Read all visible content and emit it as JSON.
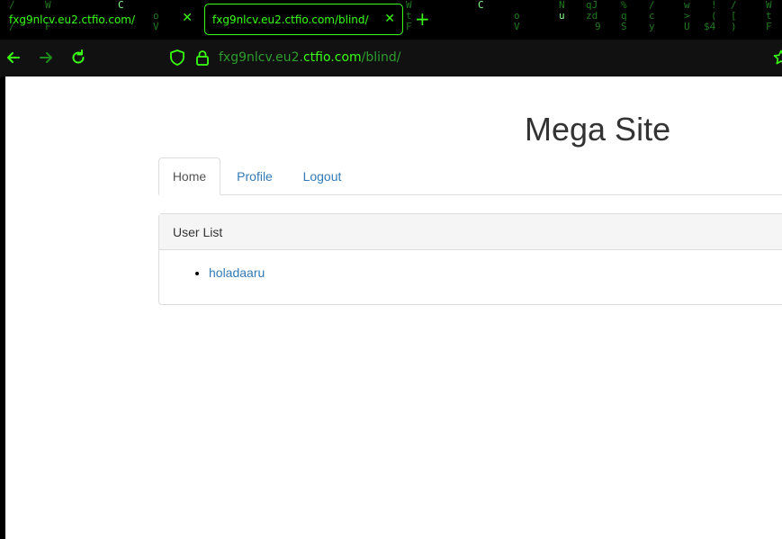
{
  "browser": {
    "tabs": [
      {
        "label": "fxg9nlcv.eu2.ctfio.com/",
        "active": false
      },
      {
        "label": "fxg9nlcv.eu2.ctfio.com/blind/",
        "active": true
      }
    ],
    "close_glyph": "✕",
    "new_tab_glyph": "+",
    "url": {
      "prefix": "fxg9nlcv.eu2.",
      "host": "ctfio.com",
      "path": "/blind/"
    },
    "theme": {
      "accent": "#39ff14",
      "background": "#000000"
    }
  },
  "page": {
    "title": "Mega Site",
    "nav": [
      {
        "label": "Home",
        "active": true
      },
      {
        "label": "Profile",
        "active": false
      },
      {
        "label": "Logout",
        "active": false
      }
    ],
    "panel": {
      "heading": "User List",
      "users": [
        "holadaaru"
      ]
    }
  }
}
